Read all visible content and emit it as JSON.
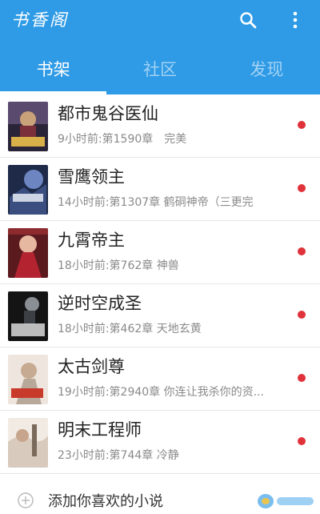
{
  "app": {
    "title": "书香阁"
  },
  "icons": {
    "search": "search-icon",
    "more": "more-vert-icon",
    "add": "plus-circle-icon"
  },
  "colors": {
    "header": "#2f9be6",
    "unread_dot": "#e0323a"
  },
  "tabs": [
    {
      "label": "书架",
      "active": true
    },
    {
      "label": "社区",
      "active": false
    },
    {
      "label": "发现",
      "active": false
    }
  ],
  "books": [
    {
      "title": "都市鬼谷医仙",
      "update": "9小时前:第1590章　完美",
      "unread": true
    },
    {
      "title": "雪鹰领主",
      "update": "14小时前:第1307章 鹤硐神帝（三更完",
      "unread": true
    },
    {
      "title": "九霄帝主",
      "update": "18小时前:第762章 神兽",
      "unread": true
    },
    {
      "title": "逆时空成圣",
      "update": "18小时前:第462章 天地玄黄",
      "unread": true
    },
    {
      "title": "太古剑尊",
      "update": "19小时前:第2940章 你连让我杀你的资...",
      "unread": true
    },
    {
      "title": "明末工程师",
      "update": "23小时前:第744章 冷静",
      "unread": true
    }
  ],
  "add_label": "添加你喜欢的小说"
}
